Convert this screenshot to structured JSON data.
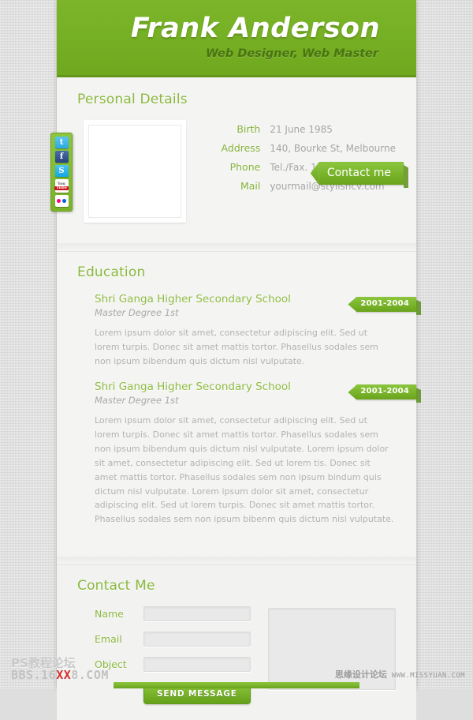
{
  "header": {
    "name": "Frank Anderson",
    "role": "Web Designer, Web Master"
  },
  "social": {
    "items": [
      {
        "name": "twitter",
        "glyph": "t"
      },
      {
        "name": "facebook",
        "glyph": "f"
      },
      {
        "name": "skype",
        "glyph": "S"
      },
      {
        "name": "youtube",
        "top": "You",
        "bottom": "Tube"
      },
      {
        "name": "flickr",
        "glyph": ""
      }
    ]
  },
  "personal": {
    "title": "Personal Details",
    "fields": [
      {
        "label": "Birth",
        "value": "21 June 1985"
      },
      {
        "label": "Address",
        "value": "140, Bourke St, Melbourne"
      },
      {
        "label": "Phone",
        "value": "Tel./Fax. 123456789"
      },
      {
        "label": "Mail",
        "value": "yourmail@stylishcv.com"
      }
    ],
    "contact_button": "Contact me"
  },
  "education": {
    "title": "Education",
    "items": [
      {
        "school": "Shri Ganga Higher Secondary School",
        "degree": "Master Degree 1st",
        "date": "2001-2004",
        "body": "Lorem ipsum dolor sit amet, consectetur adipiscing elit. Sed ut lorem turpis. Donec sit amet mattis tortor. Phasellus sodales sem non ipsum bibendum quis dictum nisl vulputate."
      },
      {
        "school": "Shri Ganga Higher Secondary School",
        "degree": "Master Degree 1st",
        "date": "2001-2004",
        "body": "Lorem ipsum dolor sit amet, consectetur adipiscing elit. Sed ut lorem turpis. Donec sit amet mattis tortor. Phasellus sodales sem non ipsum bibendum quis dictum nisl vulputate. Lorem ipsum dolor sit amet, consectetur adipiscing elit. Sed ut lorem tis. Donec sit amet mattis tortor. Phasellus sodales sem non ipsum bindum quis dictum nisl vulputate. Lorem ipsum dolor sit amet, consectetur adipiscing elit. Sed ut lorem turpis. Donec sit amet mattis tortor. Phasellus sodales sem non ipsum bibenm quis dictum nisl vulputate."
      }
    ]
  },
  "contact": {
    "title": "Contact Me",
    "name_label": "Name",
    "name_value": "",
    "email_label": "Email",
    "email_value": "",
    "object_label": "Object",
    "object_value": "",
    "message_value": "",
    "send_label": "SEND MESSAGE"
  },
  "watermarks": {
    "left_line1": "PS教程论坛",
    "left_line2_a": "BBS.16",
    "left_line2_b": "XX",
    "left_line2_c": "8.COM",
    "right_cn": "思缘设计论坛",
    "right_en": "WWW.MISSYUAN.COM"
  },
  "colors": {
    "green": "#76b024",
    "green_light": "#8cc63e",
    "label_green": "#86b23c",
    "text_gray": "#b3b3b3"
  }
}
